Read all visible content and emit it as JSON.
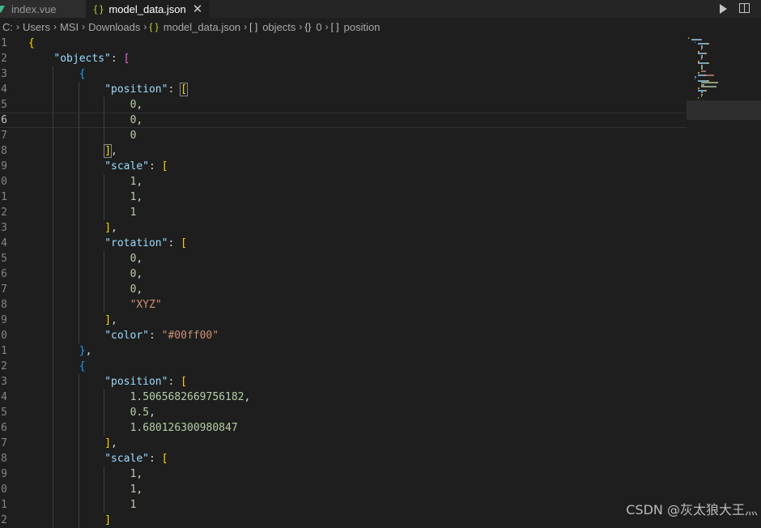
{
  "tabs": [
    {
      "label": "index.vue",
      "icon": "vue-icon",
      "active": false
    },
    {
      "label": "model_data.json",
      "icon": "json-braces-icon",
      "active": true
    }
  ],
  "breadcrumb": {
    "items": [
      "C:",
      "Users",
      "MSI",
      "Downloads",
      "model_data.json",
      "objects",
      "0",
      "position"
    ],
    "brace_glyph": "{ }",
    "array_glyph": "[ ]",
    "object_glyph": "{}"
  },
  "editor": {
    "active_line": 6,
    "line_numbers": [
      "1",
      "2",
      "3",
      "4",
      "5",
      "6",
      "7",
      "8",
      "9",
      "0",
      "1",
      "2",
      "3",
      "4",
      "5",
      "6",
      "7",
      "8",
      "9",
      "0",
      "1",
      "2",
      "3",
      "4",
      "5",
      "6",
      "7",
      "8",
      "9",
      "0",
      "1",
      "2"
    ],
    "lines": [
      {
        "indent": 0,
        "tokens": [
          {
            "t": "{",
            "c": "tk-b1"
          }
        ]
      },
      {
        "indent": 1,
        "tokens": [
          {
            "t": "\"objects\"",
            "c": "tk-key"
          },
          {
            "t": ": ",
            "c": "tk-punc"
          },
          {
            "t": "[",
            "c": "tk-b2"
          }
        ]
      },
      {
        "indent": 2,
        "tokens": [
          {
            "t": "{",
            "c": "tk-b3"
          }
        ]
      },
      {
        "indent": 3,
        "tokens": [
          {
            "t": "\"position\"",
            "c": "tk-key"
          },
          {
            "t": ": ",
            "c": "tk-punc"
          },
          {
            "t": "[",
            "c": "tk-b1 bracket-match"
          }
        ]
      },
      {
        "indent": 4,
        "tokens": [
          {
            "t": "0",
            "c": "tk-num"
          },
          {
            "t": ",",
            "c": "tk-punc"
          }
        ]
      },
      {
        "indent": 4,
        "tokens": [
          {
            "t": "0",
            "c": "tk-num"
          },
          {
            "t": ",",
            "c": "tk-punc"
          }
        ]
      },
      {
        "indent": 4,
        "tokens": [
          {
            "t": "0",
            "c": "tk-num"
          }
        ]
      },
      {
        "indent": 3,
        "tokens": [
          {
            "t": "]",
            "c": "tk-b1 bracket-match"
          },
          {
            "t": ",",
            "c": "tk-punc"
          }
        ]
      },
      {
        "indent": 3,
        "tokens": [
          {
            "t": "\"scale\"",
            "c": "tk-key"
          },
          {
            "t": ": ",
            "c": "tk-punc"
          },
          {
            "t": "[",
            "c": "tk-b1"
          }
        ]
      },
      {
        "indent": 4,
        "tokens": [
          {
            "t": "1",
            "c": "tk-num"
          },
          {
            "t": ",",
            "c": "tk-punc"
          }
        ]
      },
      {
        "indent": 4,
        "tokens": [
          {
            "t": "1",
            "c": "tk-num"
          },
          {
            "t": ",",
            "c": "tk-punc"
          }
        ]
      },
      {
        "indent": 4,
        "tokens": [
          {
            "t": "1",
            "c": "tk-num"
          }
        ]
      },
      {
        "indent": 3,
        "tokens": [
          {
            "t": "]",
            "c": "tk-b1"
          },
          {
            "t": ",",
            "c": "tk-punc"
          }
        ]
      },
      {
        "indent": 3,
        "tokens": [
          {
            "t": "\"rotation\"",
            "c": "tk-key"
          },
          {
            "t": ": ",
            "c": "tk-punc"
          },
          {
            "t": "[",
            "c": "tk-b1"
          }
        ]
      },
      {
        "indent": 4,
        "tokens": [
          {
            "t": "0",
            "c": "tk-num"
          },
          {
            "t": ",",
            "c": "tk-punc"
          }
        ]
      },
      {
        "indent": 4,
        "tokens": [
          {
            "t": "0",
            "c": "tk-num"
          },
          {
            "t": ",",
            "c": "tk-punc"
          }
        ]
      },
      {
        "indent": 4,
        "tokens": [
          {
            "t": "0",
            "c": "tk-num"
          },
          {
            "t": ",",
            "c": "tk-punc"
          }
        ]
      },
      {
        "indent": 4,
        "tokens": [
          {
            "t": "\"XYZ\"",
            "c": "tk-str"
          }
        ]
      },
      {
        "indent": 3,
        "tokens": [
          {
            "t": "]",
            "c": "tk-b1"
          },
          {
            "t": ",",
            "c": "tk-punc"
          }
        ]
      },
      {
        "indent": 3,
        "tokens": [
          {
            "t": "\"color\"",
            "c": "tk-key"
          },
          {
            "t": ": ",
            "c": "tk-punc"
          },
          {
            "t": "\"#00ff00\"",
            "c": "tk-str"
          }
        ]
      },
      {
        "indent": 2,
        "tokens": [
          {
            "t": "}",
            "c": "tk-b3"
          },
          {
            "t": ",",
            "c": "tk-punc"
          }
        ]
      },
      {
        "indent": 2,
        "tokens": [
          {
            "t": "{",
            "c": "tk-b3"
          }
        ]
      },
      {
        "indent": 3,
        "tokens": [
          {
            "t": "\"position\"",
            "c": "tk-key"
          },
          {
            "t": ": ",
            "c": "tk-punc"
          },
          {
            "t": "[",
            "c": "tk-b1"
          }
        ]
      },
      {
        "indent": 4,
        "tokens": [
          {
            "t": "1.5065682669756182",
            "c": "tk-num"
          },
          {
            "t": ",",
            "c": "tk-punc"
          }
        ]
      },
      {
        "indent": 4,
        "tokens": [
          {
            "t": "0.5",
            "c": "tk-num"
          },
          {
            "t": ",",
            "c": "tk-punc"
          }
        ]
      },
      {
        "indent": 4,
        "tokens": [
          {
            "t": "1.680126300980847",
            "c": "tk-num"
          }
        ]
      },
      {
        "indent": 3,
        "tokens": [
          {
            "t": "]",
            "c": "tk-b1"
          },
          {
            "t": ",",
            "c": "tk-punc"
          }
        ]
      },
      {
        "indent": 3,
        "tokens": [
          {
            "t": "\"scale\"",
            "c": "tk-key"
          },
          {
            "t": ": ",
            "c": "tk-punc"
          },
          {
            "t": "[",
            "c": "tk-b1"
          }
        ]
      },
      {
        "indent": 4,
        "tokens": [
          {
            "t": "1",
            "c": "tk-num"
          },
          {
            "t": ",",
            "c": "tk-punc"
          }
        ]
      },
      {
        "indent": 4,
        "tokens": [
          {
            "t": "1",
            "c": "tk-num"
          },
          {
            "t": ",",
            "c": "tk-punc"
          }
        ]
      },
      {
        "indent": 4,
        "tokens": [
          {
            "t": "1",
            "c": "tk-num"
          }
        ]
      },
      {
        "indent": 3,
        "tokens": [
          {
            "t": "]",
            "c": "tk-b1"
          }
        ]
      }
    ]
  },
  "watermark": "CSDN @灰太狼大王灬",
  "colors": {
    "background": "#1e1e1e",
    "key": "#9cdcfe",
    "string": "#ce9178",
    "number": "#b5cea8",
    "bracket_gold": "#ffd700",
    "bracket_purple": "#da70d6",
    "bracket_blue": "#179fff"
  }
}
